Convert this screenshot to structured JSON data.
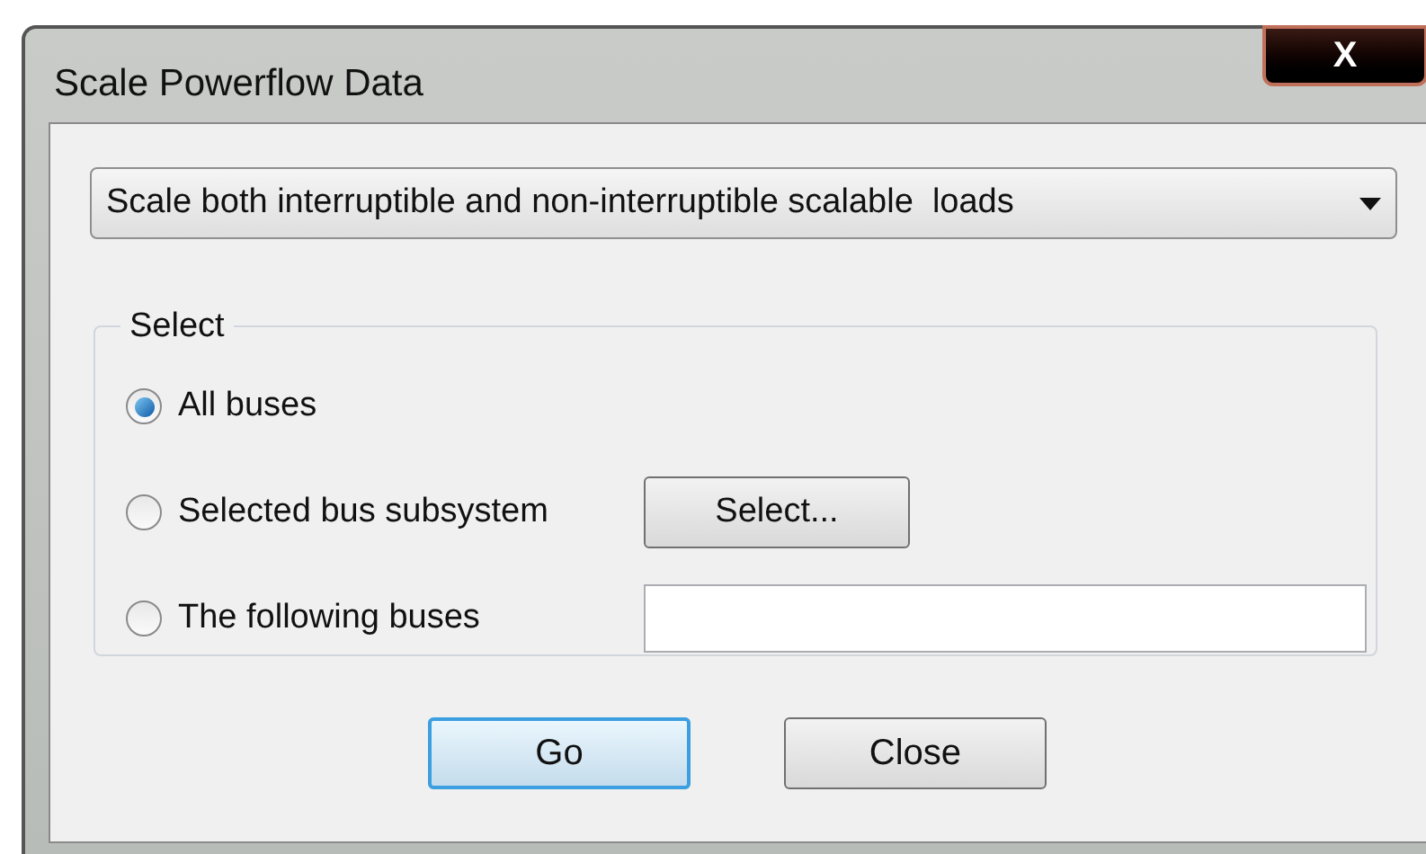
{
  "window": {
    "title": "Scale Powerflow Data",
    "close_button": "X"
  },
  "dropdown": {
    "value": "Scale both interruptible and non-interruptible scalable  loads"
  },
  "select_group": {
    "legend": "Select",
    "options": [
      {
        "label": "All buses",
        "selected": true,
        "kind": "plain"
      },
      {
        "label": "Selected bus subsystem",
        "selected": false,
        "kind": "button",
        "button": "Select..."
      },
      {
        "label": "The following buses",
        "selected": false,
        "kind": "field"
      }
    ]
  },
  "buttons": [
    {
      "label": "Go",
      "focused": true
    },
    {
      "label": "Close",
      "focused": false
    }
  ]
}
